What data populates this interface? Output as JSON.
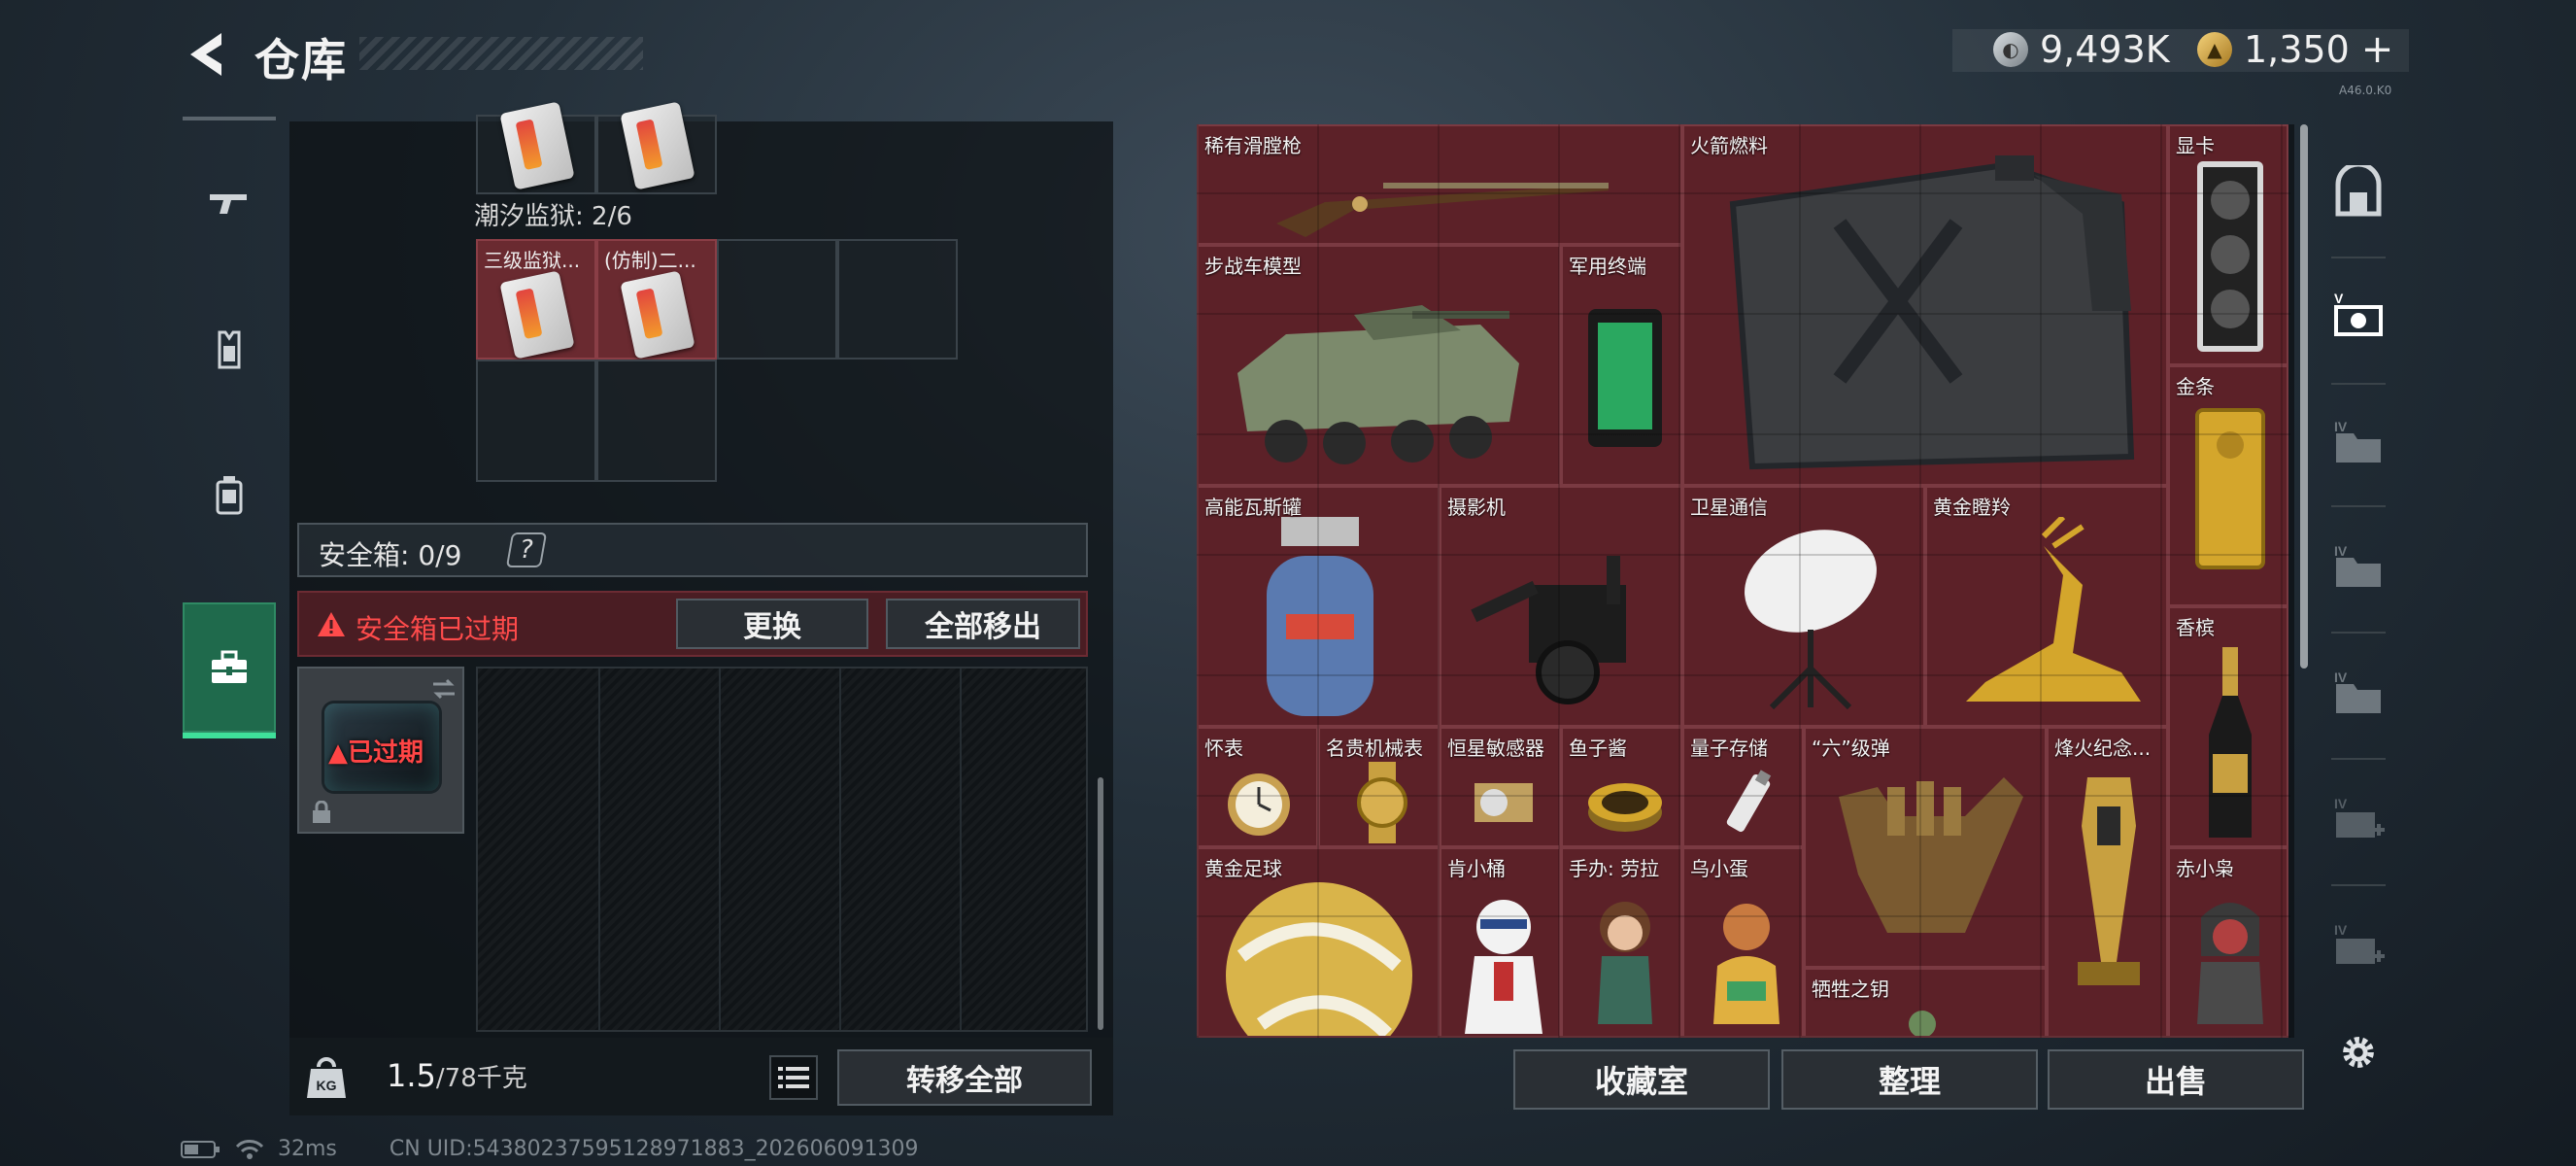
{
  "header": {
    "title": "仓库",
    "currency_a": "9,493K",
    "currency_b": "1,350",
    "currency_b_plus": "+",
    "version_tiny": "A46.0.K0"
  },
  "left_tabs": [
    {
      "name": "weapons",
      "icon": "gun-icon"
    },
    {
      "name": "armor",
      "icon": "vest-icon"
    },
    {
      "name": "backpack",
      "icon": "backpack-icon"
    },
    {
      "name": "safebox",
      "icon": "toolbox-icon",
      "active": true
    }
  ],
  "container": {
    "section_label": "潮汐监狱: 2/6",
    "cards": [
      {
        "label": "三级监狱..."
      },
      {
        "label": "(仿制)二..."
      }
    ]
  },
  "safebox": {
    "label": "安全箱: 0/9",
    "help": "?",
    "expired_message": "安全箱已过期",
    "replace_button": "更换",
    "remove_all_button": "全部移出",
    "thumb_status": "已过期"
  },
  "footer_left": {
    "weight_current": "1.5",
    "weight_max": "/78千克",
    "transfer_all_button": "转移全部"
  },
  "status_bar": {
    "ping": "32ms",
    "uid": "CN UID:54380237595128971883_202606091309"
  },
  "stash": {
    "items": [
      {
        "label": "稀有滑膛枪",
        "kind": "rifle"
      },
      {
        "label": "火箭燃料",
        "kind": "jerrycan"
      },
      {
        "label": "显卡",
        "kind": "gpu"
      },
      {
        "label": "步战车模型",
        "kind": "tank"
      },
      {
        "label": "军用终端",
        "kind": "terminal"
      },
      {
        "label": "金条",
        "kind": "goldbar"
      },
      {
        "label": "高能瓦斯罐",
        "kind": "gascan"
      },
      {
        "label": "摄影机",
        "kind": "camera"
      },
      {
        "label": "卫星通信",
        "kind": "dish"
      },
      {
        "label": "黄金瞪羚",
        "kind": "gazelle"
      },
      {
        "label": "香槟",
        "kind": "champagne"
      },
      {
        "label": "怀表",
        "kind": "pocketwatch"
      },
      {
        "label": "名贵机械表",
        "kind": "watch"
      },
      {
        "label": "恒星敏感器",
        "kind": "sensor"
      },
      {
        "label": "鱼子酱",
        "kind": "caviar"
      },
      {
        "label": "量子存储",
        "kind": "usb"
      },
      {
        "label": "“六”级弹",
        "kind": "hand"
      },
      {
        "label": "烽火纪念...",
        "kind": "trophy"
      },
      {
        "label": "黄金足球",
        "kind": "ball"
      },
      {
        "label": "肯小桶",
        "kind": "figure1"
      },
      {
        "label": "手办: 劳拉",
        "kind": "figure2"
      },
      {
        "label": "乌小蛋",
        "kind": "figure3"
      },
      {
        "label": "牺牲之钥",
        "kind": "key"
      },
      {
        "label": "赤小枭",
        "kind": "figure4"
      }
    ],
    "buttons": {
      "collection": "收藏室",
      "organize": "整理",
      "sell": "出售"
    }
  },
  "colors": {
    "item_red": "#5c2128",
    "accent_green": "#3fe09a",
    "warning_red": "#ff4b4b"
  }
}
